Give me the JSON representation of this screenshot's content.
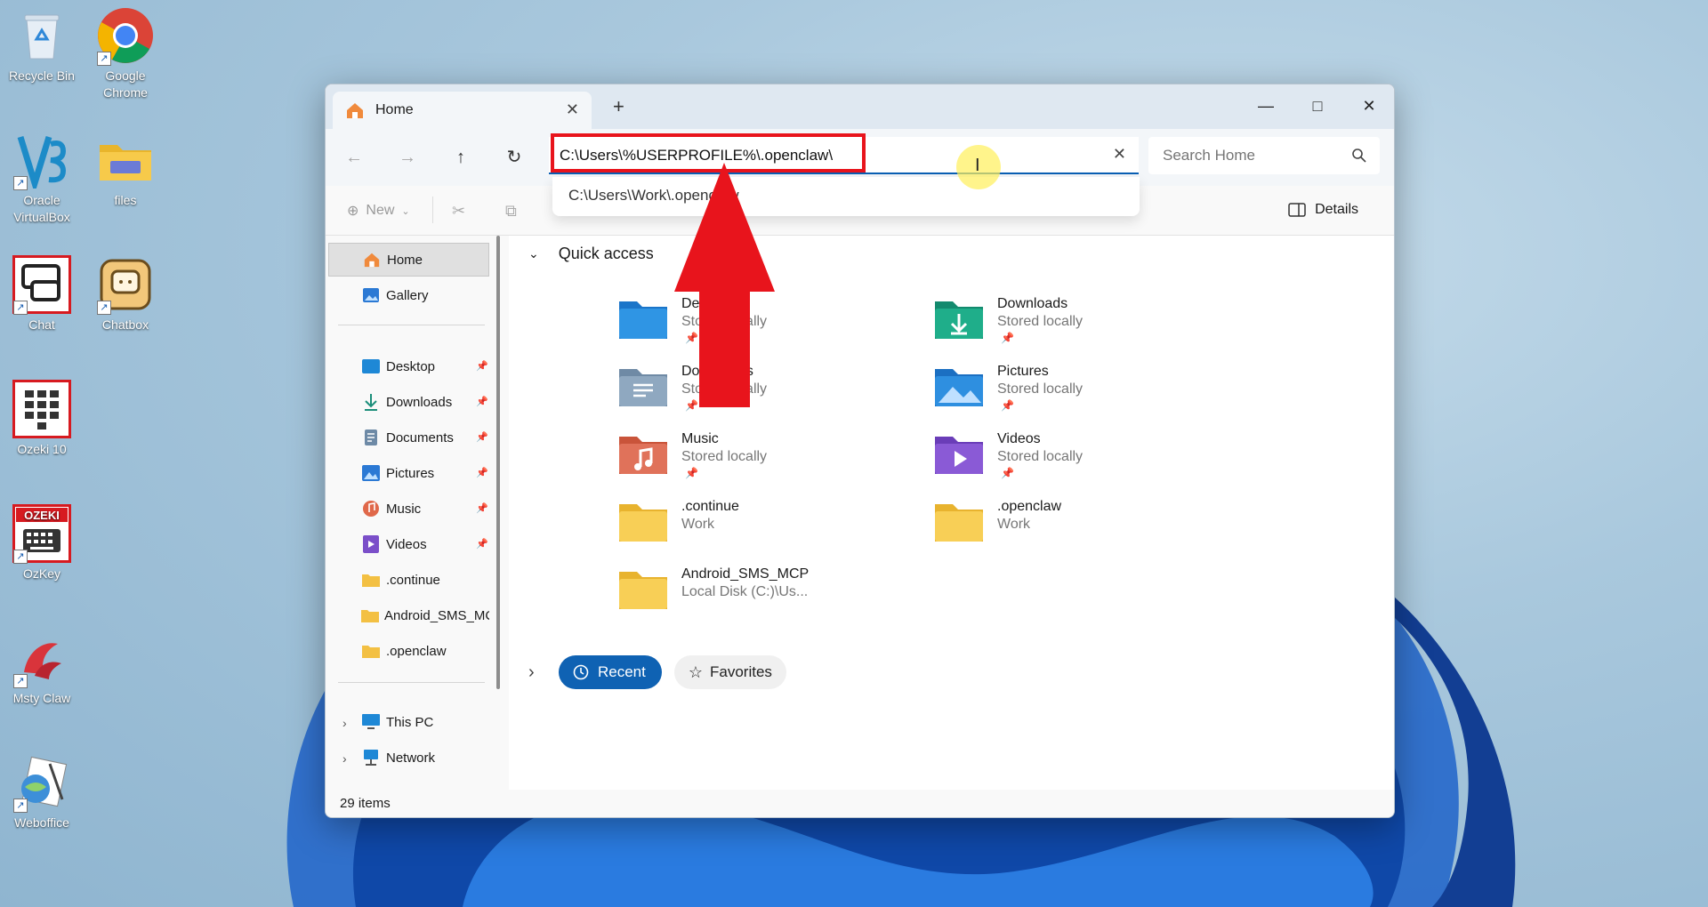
{
  "desktop": {
    "icons": [
      {
        "label": "Recycle Bin",
        "icon": "recycle-bin-icon"
      },
      {
        "label": "Google Chrome",
        "icon": "chrome-icon"
      },
      {
        "label": "Oracle VirtualBox",
        "icon": "virtualbox-icon"
      },
      {
        "label": "files",
        "icon": "folder-icon"
      },
      {
        "label": "Chat",
        "icon": "chat-icon"
      },
      {
        "label": "Chatbox",
        "icon": "chatbox-icon"
      },
      {
        "label": "Ozeki 10",
        "icon": "ozeki-icon"
      },
      {
        "label": "OzKey",
        "icon": "ozkey-icon",
        "badge": "OZEKI"
      },
      {
        "label": "Msty Claw",
        "icon": "msty-claw-icon"
      },
      {
        "label": "Weboffice",
        "icon": "weboffice-icon"
      }
    ]
  },
  "window": {
    "tab_label": "Home",
    "address_value": "C:\\Users\\%USERPROFILE%\\.openclaw\\",
    "suggestion": "C:\\Users\\Work\\.openclaw",
    "search_placeholder": "Search Home",
    "cmd_new": "New",
    "details_label": "Details",
    "status_items": "29 items"
  },
  "sidebar": {
    "top": [
      {
        "label": "Home",
        "icon": "home-icon"
      },
      {
        "label": "Gallery",
        "icon": "gallery-icon"
      }
    ],
    "pinned": [
      {
        "label": "Desktop",
        "icon": "desktop-icon"
      },
      {
        "label": "Downloads",
        "icon": "downloads-icon"
      },
      {
        "label": "Documents",
        "icon": "documents-icon"
      },
      {
        "label": "Pictures",
        "icon": "pictures-icon"
      },
      {
        "label": "Music",
        "icon": "music-icon"
      },
      {
        "label": "Videos",
        "icon": "videos-icon"
      },
      {
        "label": ".continue",
        "icon": "folder-icon"
      },
      {
        "label": "Android_SMS_MC",
        "icon": "folder-icon"
      },
      {
        "label": ".openclaw",
        "icon": "folder-icon"
      }
    ],
    "bottom": [
      {
        "label": "This PC",
        "icon": "this-pc-icon"
      },
      {
        "label": "Network",
        "icon": "network-icon"
      }
    ]
  },
  "main": {
    "quick_access_label": "Quick access",
    "items": [
      {
        "name": "Desktop",
        "sub": "Stored locally",
        "pinned": true,
        "icon": "desktop-folder-icon"
      },
      {
        "name": "Downloads",
        "sub": "Stored locally",
        "pinned": true,
        "icon": "downloads-folder-icon"
      },
      {
        "name": "Documents",
        "sub": "Stored locally",
        "pinned": true,
        "icon": "documents-folder-icon"
      },
      {
        "name": "Pictures",
        "sub": "Stored locally",
        "pinned": true,
        "icon": "pictures-folder-icon"
      },
      {
        "name": "Music",
        "sub": "Stored locally",
        "pinned": true,
        "icon": "music-folder-icon"
      },
      {
        "name": "Videos",
        "sub": "Stored locally",
        "pinned": true,
        "icon": "videos-folder-icon"
      },
      {
        "name": ".continue",
        "sub": "Work",
        "pinned": false,
        "icon": "folder-icon"
      },
      {
        "name": ".openclaw",
        "sub": "Work",
        "pinned": false,
        "icon": "folder-icon"
      },
      {
        "name": "Android_SMS_MCP",
        "sub": "Local Disk (C:)\\Us...",
        "pinned": false,
        "icon": "folder-icon"
      }
    ],
    "recent_label": "Recent",
    "favorites_label": "Favorites"
  },
  "colors": {
    "accent": "#0f62b3",
    "highlight_red": "#e8141c"
  }
}
